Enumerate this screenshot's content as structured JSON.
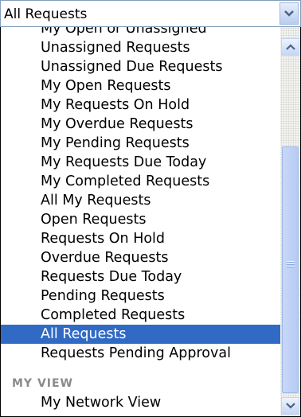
{
  "select": {
    "value": "All Requests",
    "arrow_icon": "chevron-down-icon"
  },
  "dropdown": {
    "items": [
      {
        "label": "My Open or Unassigned"
      },
      {
        "label": "Unassigned Requests"
      },
      {
        "label": "Unassigned Due Requests"
      },
      {
        "label": "My Open Requests"
      },
      {
        "label": "My Requests On Hold"
      },
      {
        "label": "My Overdue Requests"
      },
      {
        "label": "My Pending Requests"
      },
      {
        "label": "My Requests Due Today"
      },
      {
        "label": "My Completed Requests"
      },
      {
        "label": "All My Requests"
      },
      {
        "label": "Open Requests"
      },
      {
        "label": "Requests On Hold"
      },
      {
        "label": "Overdue Requests"
      },
      {
        "label": "Requests Due Today"
      },
      {
        "label": "Pending Requests"
      },
      {
        "label": "Completed Requests"
      },
      {
        "label": "All Requests"
      },
      {
        "label": "Requests Pending Approval"
      }
    ],
    "selected_item": "All Requests",
    "group_header": "MY VIEW",
    "group_items": [
      {
        "label": "My Network View"
      }
    ]
  },
  "scrollbar": {
    "up_icon": "scroll-up-arrow-icon",
    "down_icon": "scroll-down-arrow-icon"
  },
  "colors": {
    "selection_background": "#316ac5",
    "selection_text": "#ffffff",
    "group_header_text": "#8a8a8a"
  }
}
